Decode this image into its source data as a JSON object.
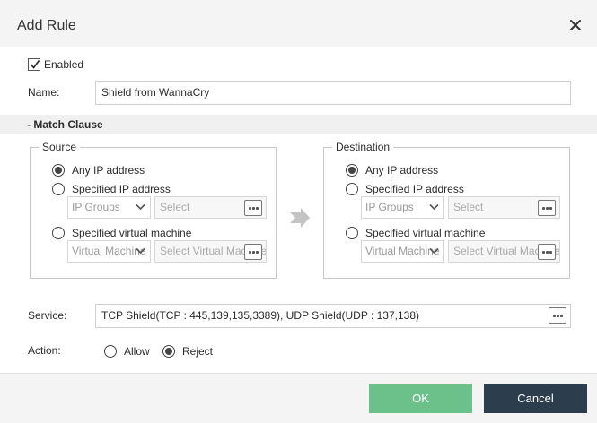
{
  "dialog": {
    "title": "Add Rule",
    "close_icon": "close-icon"
  },
  "form": {
    "enabled_label": "Enabled",
    "enabled_checked": true,
    "name_label": "Name:",
    "name_value": "Shield from WannaCry",
    "match_clause_label": "- Match Clause",
    "service_label": "Service:",
    "service_value": "TCP Shield(TCP : 445,139,135,3389), UDP Shield(UDP : 137,138)",
    "action_label": "Action:",
    "action_options": [
      "Allow",
      "Reject"
    ],
    "action_selected": "Reject"
  },
  "source": {
    "legend": "Source",
    "any_ip_label": "Any IP address",
    "specified_ip_label": "Specified IP address",
    "ip_groups_placeholder": "IP Groups",
    "ip_select_placeholder": "Select",
    "specified_vm_label": "Specified virtual machine",
    "vm_select_placeholder": "Virtual Machine",
    "vm_picker_placeholder": "Select Virtual Machine",
    "selected": "any_ip"
  },
  "destination": {
    "legend": "Destination",
    "any_ip_label": "Any IP address",
    "specified_ip_label": "Specified IP address",
    "ip_groups_placeholder": "IP Groups",
    "ip_select_placeholder": "Select",
    "specified_vm_label": "Specified virtual machine",
    "vm_select_placeholder": "Virtual Machine",
    "vm_picker_placeholder": "Select Virtual Machine",
    "selected": "any_ip"
  },
  "buttons": {
    "ok_label": "OK",
    "cancel_label": "Cancel"
  },
  "colors": {
    "ok": "#6cc18b",
    "cancel": "#2c3e4e",
    "header": "#f4f4f4"
  }
}
